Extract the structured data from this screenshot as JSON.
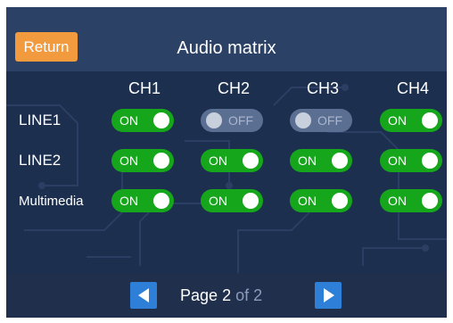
{
  "header": {
    "return_label": "Return",
    "title": "Audio matrix"
  },
  "columns": [
    "CH1",
    "CH2",
    "CH3",
    "CH4"
  ],
  "rows": [
    {
      "label": "LINE1",
      "states": [
        "ON",
        "OFF",
        "OFF",
        "ON"
      ]
    },
    {
      "label": "LINE2",
      "states": [
        "ON",
        "ON",
        "ON",
        "ON"
      ]
    },
    {
      "label": "Multimedia",
      "states": [
        "ON",
        "ON",
        "ON",
        "ON"
      ]
    }
  ],
  "pager": {
    "prefix": "Page",
    "current": "2",
    "of_word": "of",
    "total": "2",
    "prev_icon": "triangle-left-icon",
    "next_icon": "triangle-right-icon"
  },
  "colors": {
    "on": "#16a61b",
    "off": "#5b6f93",
    "return_button": "#f29a3e",
    "nav_button": "#2e7fd8"
  }
}
